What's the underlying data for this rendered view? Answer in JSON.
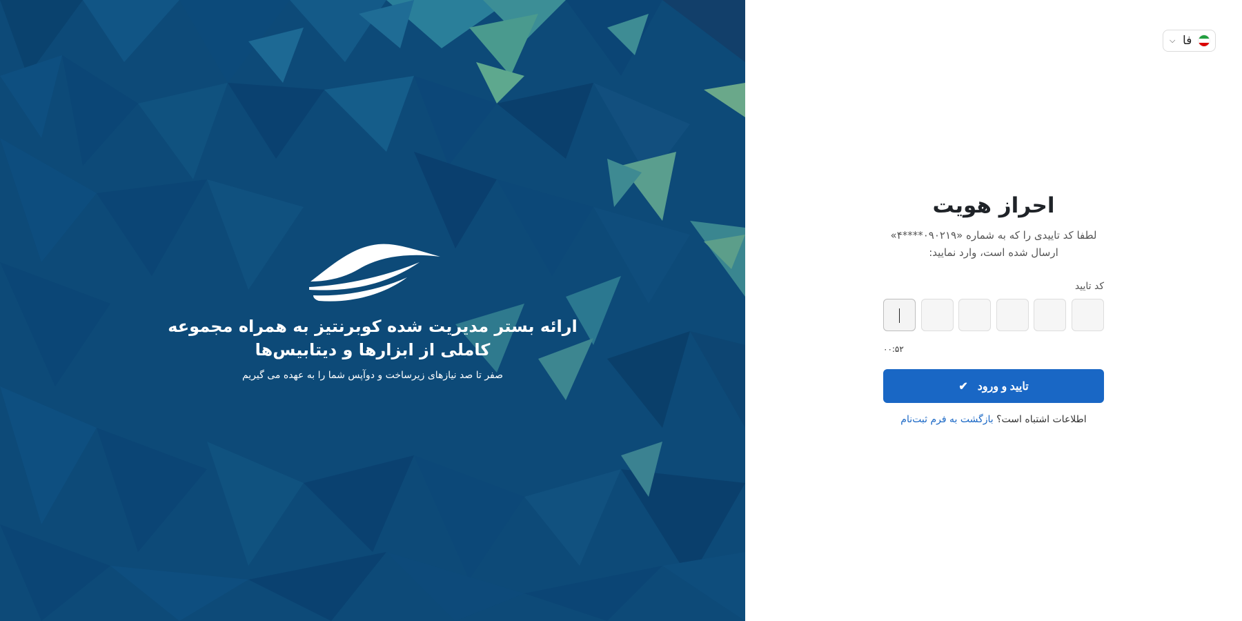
{
  "language": {
    "label": "فا",
    "flag_icon": "iran-flag-icon"
  },
  "hero": {
    "title": "ارائه بستر مدیریت شده کوبرنتیز به همراه مجموعه کاملی از ابزارها و دیتابیس‌ها",
    "subtitle": "صفر تا صد نیازهای زیرساخت و دوآپس شما را به عهده می گیریم",
    "logo_icon": "boat-logo-icon",
    "background_color": "#0d4a78"
  },
  "form": {
    "title": "احراز هویت",
    "instruction_line1": "لطفا کد تاییدی را که به شماره «۰۹۰۲۱۹****۴»",
    "instruction_line2": "ارسال شده است، وارد نمایید:",
    "code_label": "کد تایید",
    "otp_length": 6,
    "timer": "۰۰:۵۲",
    "submit_label": "تایید و ورود",
    "wrong_info_text": "اطلاعات اشتباه است؟",
    "back_link": "بازگشت به فرم ثبت‌نام",
    "accent_color": "#1967c5"
  }
}
